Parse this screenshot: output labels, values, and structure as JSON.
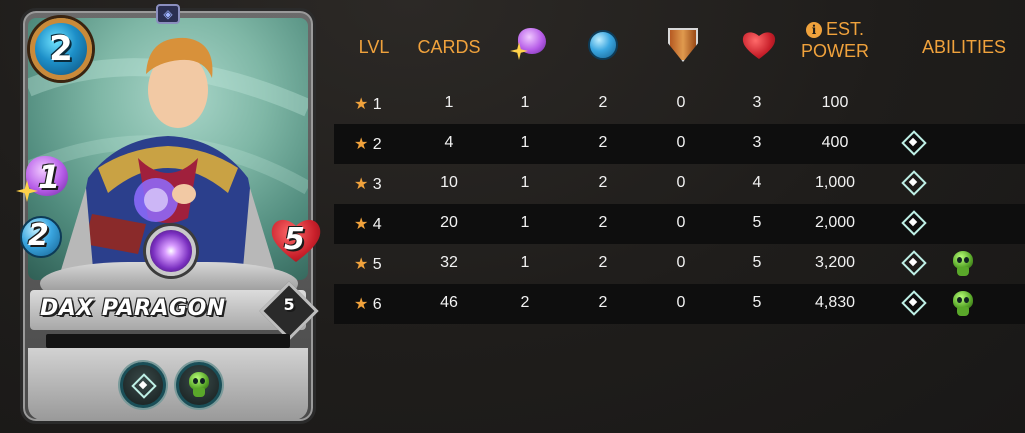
{
  "card": {
    "name": "DAX PARAGON",
    "mana": "2",
    "magic": "1",
    "speed": "2",
    "health": "5",
    "level": "5",
    "abilities": [
      {
        "icon": "diamond-icon"
      },
      {
        "icon": "skull-icon"
      }
    ]
  },
  "table": {
    "headers": {
      "lvl": "LVL",
      "cards": "CARDS",
      "magic_icon": "magic-icon",
      "speed_icon": "speed-icon",
      "armor_icon": "shield-icon",
      "health_icon": "heart-icon",
      "est": "EST.",
      "power": "POWER",
      "abilities": "ABILITIES"
    },
    "rows": [
      {
        "lvl": "1",
        "cards": "1",
        "magic": "1",
        "speed": "2",
        "armor": "0",
        "health": "3",
        "power": "100",
        "abilities": []
      },
      {
        "lvl": "2",
        "cards": "4",
        "magic": "1",
        "speed": "2",
        "armor": "0",
        "health": "3",
        "power": "400",
        "abilities": [
          "diamond-icon"
        ]
      },
      {
        "lvl": "3",
        "cards": "10",
        "magic": "1",
        "speed": "2",
        "armor": "0",
        "health": "4",
        "power": "1,000",
        "abilities": [
          "diamond-icon"
        ]
      },
      {
        "lvl": "4",
        "cards": "20",
        "magic": "1",
        "speed": "2",
        "armor": "0",
        "health": "5",
        "power": "2,000",
        "abilities": [
          "diamond-icon"
        ]
      },
      {
        "lvl": "5",
        "cards": "32",
        "magic": "1",
        "speed": "2",
        "armor": "0",
        "health": "5",
        "power": "3,200",
        "abilities": [
          "diamond-icon",
          "skull-icon"
        ]
      },
      {
        "lvl": "6",
        "cards": "46",
        "magic": "2",
        "speed": "2",
        "armor": "0",
        "health": "5",
        "power": "4,830",
        "abilities": [
          "diamond-icon",
          "skull-icon"
        ]
      }
    ]
  },
  "colors": {
    "accent": "#f0a23c",
    "background": "#1f1d1b",
    "row_dark": "#0e0e0e"
  }
}
